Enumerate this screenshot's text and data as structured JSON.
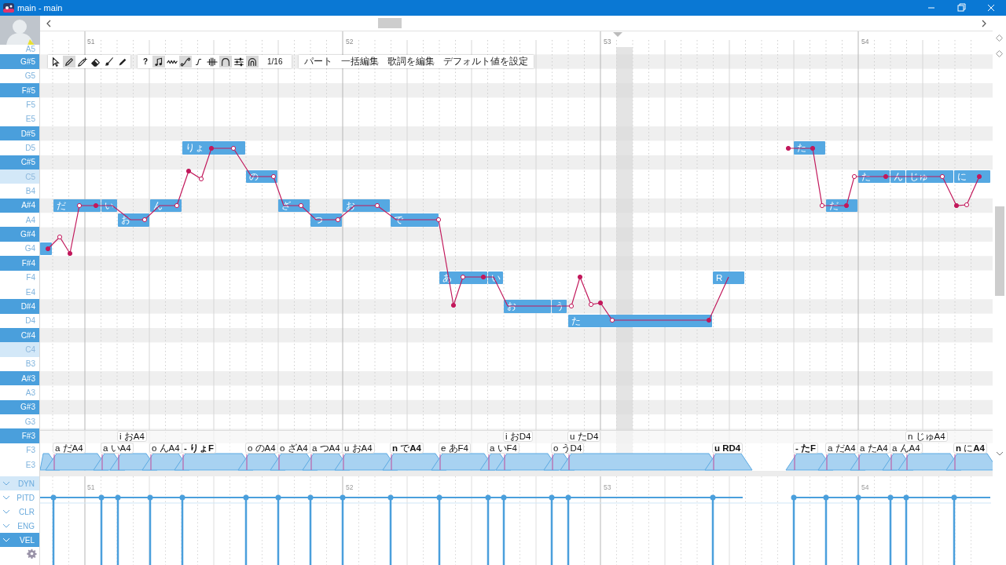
{
  "window": {
    "title": "main - main"
  },
  "piano_keys": [
    {
      "label": "A5",
      "kind": "white"
    },
    {
      "label": "G#5",
      "kind": "black"
    },
    {
      "label": "G5",
      "kind": "white"
    },
    {
      "label": "F#5",
      "kind": "black"
    },
    {
      "label": "F5",
      "kind": "white"
    },
    {
      "label": "E5",
      "kind": "white"
    },
    {
      "label": "D#5",
      "kind": "black"
    },
    {
      "label": "D5",
      "kind": "white"
    },
    {
      "label": "C#5",
      "kind": "black"
    },
    {
      "label": "C5",
      "kind": "c"
    },
    {
      "label": "B4",
      "kind": "white"
    },
    {
      "label": "A#4",
      "kind": "black"
    },
    {
      "label": "A4",
      "kind": "white"
    },
    {
      "label": "G#4",
      "kind": "black"
    },
    {
      "label": "G4",
      "kind": "white"
    },
    {
      "label": "F#4",
      "kind": "black"
    },
    {
      "label": "F4",
      "kind": "white"
    },
    {
      "label": "E4",
      "kind": "white"
    },
    {
      "label": "D#4",
      "kind": "black"
    },
    {
      "label": "D4",
      "kind": "white"
    },
    {
      "label": "C#4",
      "kind": "black"
    },
    {
      "label": "C4",
      "kind": "c"
    },
    {
      "label": "B3",
      "kind": "white"
    },
    {
      "label": "A#3",
      "kind": "black"
    },
    {
      "label": "A3",
      "kind": "white"
    },
    {
      "label": "G#3",
      "kind": "black"
    },
    {
      "label": "G3",
      "kind": "white"
    },
    {
      "label": "F#3",
      "kind": "black"
    },
    {
      "label": "F3",
      "kind": "white"
    },
    {
      "label": "E3",
      "kind": "white"
    }
  ],
  "ruler": [
    "51",
    "52",
    "53",
    "54"
  ],
  "toolbar": {
    "tools": [
      {
        "kind": "pointer",
        "selected": false
      },
      {
        "kind": "pencil",
        "selected": true
      },
      {
        "kind": "sparkle-pencil",
        "selected": false
      },
      {
        "kind": "eraser",
        "selected": false
      },
      {
        "kind": "brush",
        "selected": false
      },
      {
        "kind": "pen",
        "selected": false
      }
    ],
    "toggles": [
      {
        "kind": "text",
        "label": "?",
        "selected": false
      },
      {
        "kind": "note",
        "selected": true
      },
      {
        "kind": "wave",
        "selected": false
      },
      {
        "kind": "curve",
        "selected": true
      },
      {
        "kind": "step",
        "selected": false
      },
      {
        "kind": "comb",
        "selected": false
      },
      {
        "kind": "arch",
        "selected": true
      },
      {
        "kind": "sliders",
        "selected": false
      },
      {
        "kind": "double-arch",
        "selected": true
      },
      {
        "kind": "text",
        "label": "1/16",
        "selected": false
      }
    ],
    "menu": [
      "パート",
      "一括編集",
      "歌詞を編集",
      "デフォルト値を設定"
    ]
  },
  "notes": [
    {
      "selected": false
    },
    {
      "lyric": "だ",
      "selected": false,
      "phoneme": {
        "text": "a だA4",
        "bold": false
      }
    },
    {
      "lyric": "い",
      "selected": false,
      "phoneme": {
        "text": "a いA4",
        "bold": false
      }
    },
    {
      "lyric": "お",
      "selected": false,
      "phoneme": {
        "text": "i おA4",
        "bold": false
      }
    },
    {
      "lyric": "ん",
      "selected": false,
      "phoneme": {
        "text": "o んA4",
        "bold": false
      }
    },
    {
      "lyric": "りょ",
      "selected": false,
      "phoneme": {
        "text": "- りょF",
        "bold": true
      }
    },
    {
      "lyric": "の",
      "selected": false,
      "phoneme": {
        "text": "o のA4",
        "bold": false
      }
    },
    {
      "lyric": "ざ",
      "selected": false,
      "phoneme": {
        "text": "o ざA4",
        "bold": false
      }
    },
    {
      "lyric": "つ",
      "selected": false,
      "phoneme": {
        "text": "a つA4",
        "bold": false
      }
    },
    {
      "lyric": "お",
      "selected": false,
      "phoneme": {
        "text": "u おA4",
        "bold": false
      }
    },
    {
      "lyric": "で",
      "selected": false,
      "phoneme": {
        "text": "**n** で**A4**",
        "bold": false
      }
    },
    {
      "lyric": "あ",
      "selected": false,
      "phoneme": {
        "text": "e あF4",
        "bold": false
      }
    },
    {
      "lyric": "い",
      "selected": false,
      "phoneme": {
        "text": "a いF4",
        "bold": false
      }
    },
    {
      "lyric": "お",
      "selected": false,
      "phoneme": {
        "text": "i おD4",
        "bold": false
      }
    },
    {
      "lyric": "う",
      "selected": false,
      "phoneme": {
        "text": "o うD4",
        "bold": false
      }
    },
    {
      "lyric": "た",
      "selected": false,
      "phoneme": {
        "text": "u たD4",
        "bold": false
      }
    },
    {
      "lyric": "R",
      "selected": false,
      "phoneme": {
        "text": "u RD4",
        "bold": true
      }
    },
    {
      "lyric": "た",
      "selected": false,
      "phoneme": {
        "text": "- たF",
        "bold": true
      }
    },
    {
      "lyric": "だ",
      "selected": false,
      "phoneme": {
        "text": "a だA4",
        "bold": false
      }
    },
    {
      "lyric": "た",
      "selected": false,
      "phoneme": {
        "text": "a たA4",
        "bold": false
      }
    },
    {
      "lyric": "ん",
      "selected": false,
      "phoneme": {
        "text": "a んA4",
        "bold": false
      }
    },
    {
      "lyric": "じゅ",
      "selected": false,
      "phoneme": {
        "text": "n じゅA4",
        "bold": false
      }
    },
    {
      "lyric": "に",
      "selected": false,
      "phoneme": {
        "text": "**n** に**A4**",
        "bold": false
      }
    }
  ],
  "expressions": {
    "tracks": [
      {
        "label": "DYN",
        "highlighted": true,
        "selected": false
      },
      {
        "label": "PITD",
        "highlighted": false,
        "selected": false
      },
      {
        "label": "CLR",
        "highlighted": false,
        "selected": false
      },
      {
        "label": "ENG",
        "highlighted": false,
        "selected": false
      },
      {
        "label": "VEL",
        "highlighted": false,
        "selected": true
      }
    ],
    "ruler": [
      "51",
      "52",
      "53",
      "54"
    ]
  }
}
